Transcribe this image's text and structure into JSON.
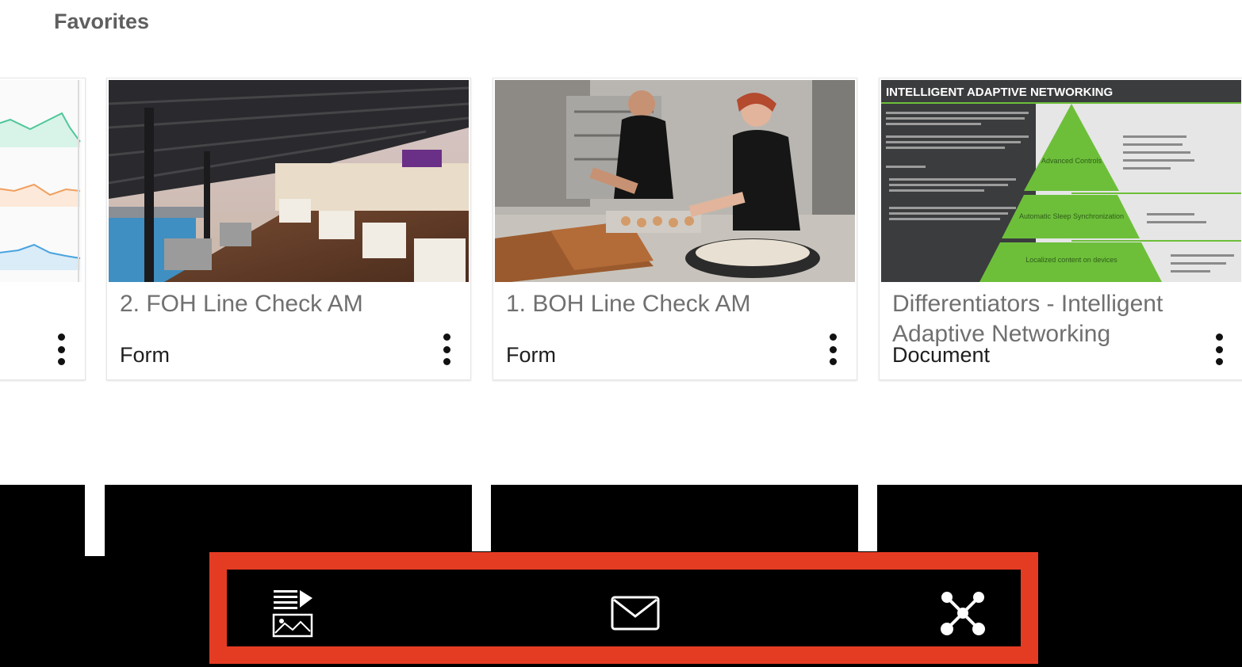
{
  "section": {
    "title": "Favorites"
  },
  "cards": [
    {
      "title": "",
      "type": ""
    },
    {
      "title": "2. FOH Line Check AM",
      "type": "Form"
    },
    {
      "title": "1. BOH Line Check AM",
      "type": "Form"
    },
    {
      "title": "Differentiators - Intelligent Adaptive Networking",
      "type": "Document",
      "thumbnail_text": {
        "heading": "INTELLIGENT ADAPTIVE NETWORKING",
        "pyramid_levels": [
          "Advanced Controls",
          "Automatic Sleep Synchronization",
          "Localized content on devices"
        ]
      }
    }
  ],
  "toolbar": {
    "icons": [
      "media-list-icon",
      "mail-icon",
      "share-network-icon"
    ]
  },
  "colors": {
    "toolbar_border": "#e43c23",
    "background_bottom": "#000000",
    "chart_green": "#4fc79a",
    "chart_orange": "#f0a060",
    "chart_blue": "#4aa3df",
    "doc_green": "#6dbf3a"
  }
}
